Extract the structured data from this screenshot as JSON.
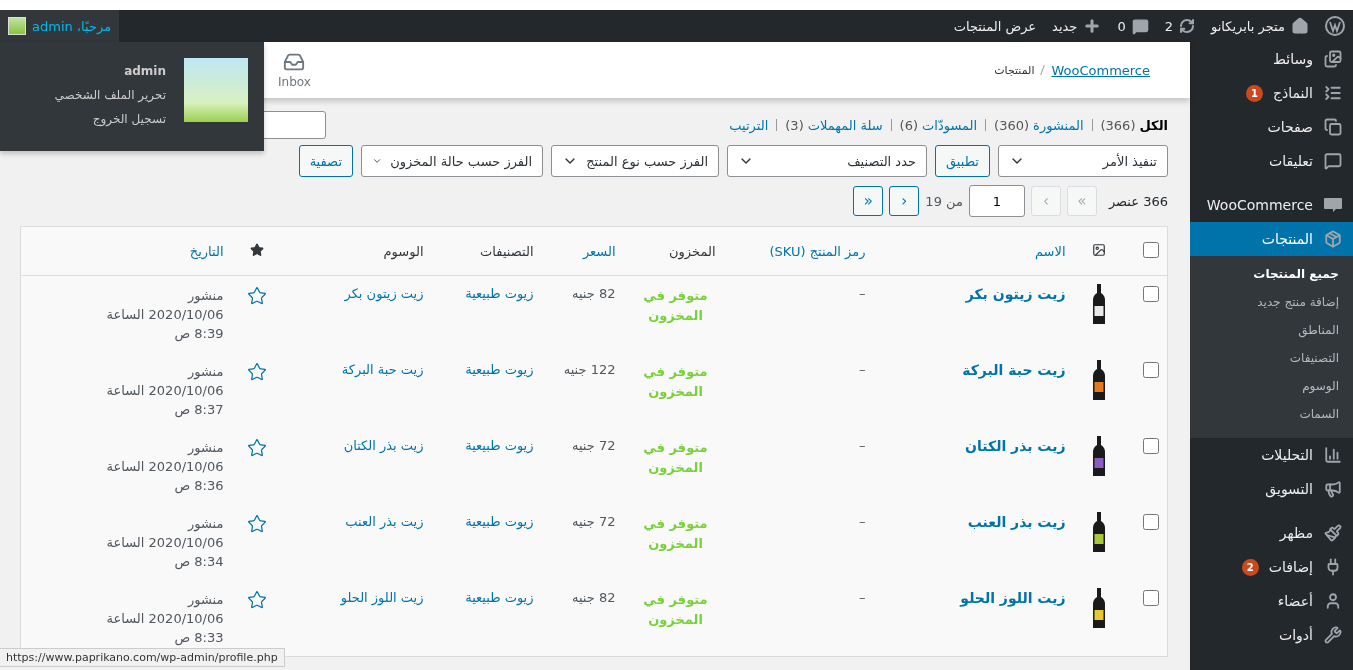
{
  "admin_bar": {
    "site": "متجر بابريكانو",
    "updates": "2",
    "comments": "0",
    "new": "جديد",
    "view": "عرض المنتجات",
    "account": "مرحبًا، admin"
  },
  "account_menu": {
    "username": "admin",
    "links": [
      "تحرير الملف الشخصي",
      "تسجيل الخروج"
    ]
  },
  "sidebar": {
    "items": [
      {
        "label": "وسائط",
        "selected": false
      },
      {
        "label": "النماذج",
        "badge": "1",
        "selected": false
      },
      {
        "label": "صفحات",
        "selected": false
      },
      {
        "label": "تعليقات",
        "selected": false
      },
      {
        "label": "WooCommerce",
        "selected": false
      },
      {
        "label": "المنتجات",
        "selected": true,
        "children": [
          {
            "label": "جميع المنتجات",
            "selected": true
          },
          {
            "label": "إضافة منتج جديد",
            "selected": false
          },
          {
            "label": "المناطق",
            "selected": false
          },
          {
            "label": "التصنيفات",
            "selected": false
          },
          {
            "label": "الوسوم",
            "selected": false
          },
          {
            "label": "السمات",
            "selected": false
          }
        ]
      },
      {
        "label": "التحليلات",
        "selected": false
      },
      {
        "label": "التسويق",
        "selected": false
      },
      {
        "label": "مظهر",
        "selected": false
      },
      {
        "label": "إضافات",
        "badge": "2",
        "selected": false
      },
      {
        "label": "أعضاء",
        "selected": false
      },
      {
        "label": "أدوات",
        "selected": false
      }
    ]
  },
  "header": {
    "breadcrumb_link": "WooCommerce",
    "breadcrumb_current": "المنتجات",
    "inbox": "Inbox"
  },
  "views": [
    {
      "label": "الكل",
      "count": "(366)",
      "selected": true
    },
    {
      "label": "المنشورة",
      "count": "(360)",
      "selected": false
    },
    {
      "label": "المسودّات",
      "count": "(6)",
      "selected": false
    },
    {
      "label": "سلة المهملات",
      "count": "(3)",
      "selected": false
    },
    {
      "label": "الترتيب",
      "selected": false
    }
  ],
  "filters": {
    "bulk_action": "تنفيذ الأمر",
    "apply": "تطبيق",
    "selects": [
      "حدد التصنيف",
      "الفرز حسب نوع المنتج",
      "الفرز حسب حالة المخزون"
    ],
    "filter": "تصفية"
  },
  "pagination": {
    "count": "366 عنصر",
    "buttons_before": [
      {
        "label": "«",
        "disabled": true
      },
      {
        "label": "‹",
        "disabled": true
      }
    ],
    "page": "1",
    "of": "من 19",
    "buttons_after": [
      {
        "label": "›",
        "disabled": false
      },
      {
        "label": "»",
        "disabled": false
      }
    ]
  },
  "table": {
    "select_all_checked": false,
    "columns": [
      {
        "kind": "image"
      },
      {
        "kind": "text",
        "label": "الاسم",
        "sortable": true
      },
      {
        "kind": "text",
        "label": "رمز المنتج (SKU)",
        "sortable": true
      },
      {
        "kind": "text",
        "label": "المخزون",
        "sortable": false
      },
      {
        "kind": "text",
        "label": "السعر",
        "sortable": true
      },
      {
        "kind": "text",
        "label": "التصنيفات",
        "sortable": false
      },
      {
        "kind": "text",
        "label": "الوسوم",
        "sortable": false
      },
      {
        "kind": "featured"
      },
      {
        "kind": "text",
        "label": "التاريخ",
        "sortable": true
      }
    ],
    "rows": [
      {
        "checked": false,
        "name": "زيت زيتون بكر",
        "sku": "–",
        "stock": "متوفر في المخزون",
        "price": "82 جنيه",
        "category": "زيوت طبيعية",
        "tag": "زيت زيتون بكر",
        "featured": false,
        "status": "منشور",
        "date": "2020/10/06 الساعة 8:39 ص"
      },
      {
        "checked": false,
        "name": "زيت حبة البركة",
        "sku": "–",
        "stock": "متوفر في المخزون",
        "price": "122 جنيه",
        "category": "زيوت طبيعية",
        "tag": "زيت حبة البركة",
        "featured": false,
        "status": "منشور",
        "date": "2020/10/06 الساعة 8:37 ص"
      },
      {
        "checked": false,
        "name": "زيت بذر الكتان",
        "sku": "–",
        "stock": "متوفر في المخزون",
        "price": "72 جنيه",
        "category": "زيوت طبيعية",
        "tag": "زيت بذر الكتان",
        "featured": false,
        "status": "منشور",
        "date": "2020/10/06 الساعة 8:36 ص"
      },
      {
        "checked": false,
        "name": "زيت بذر العنب",
        "sku": "–",
        "stock": "متوفر في المخزون",
        "price": "72 جنيه",
        "category": "زيوت طبيعية",
        "tag": "زيت بذر العنب",
        "featured": false,
        "status": "منشور",
        "date": "2020/10/06 الساعة 8:34 ص"
      },
      {
        "checked": false,
        "name": "زيت اللوز الحلو",
        "sku": "–",
        "stock": "متوفر في المخزون",
        "price": "82 جنيه",
        "category": "زيوت طبيعية",
        "tag": "زيت اللوز الحلو",
        "featured": false,
        "status": "منشور",
        "date": "2020/10/06 الساعة 8:33 ص"
      }
    ]
  },
  "status_url": "https://www.paprikano.com/wp-admin/profile.php"
}
